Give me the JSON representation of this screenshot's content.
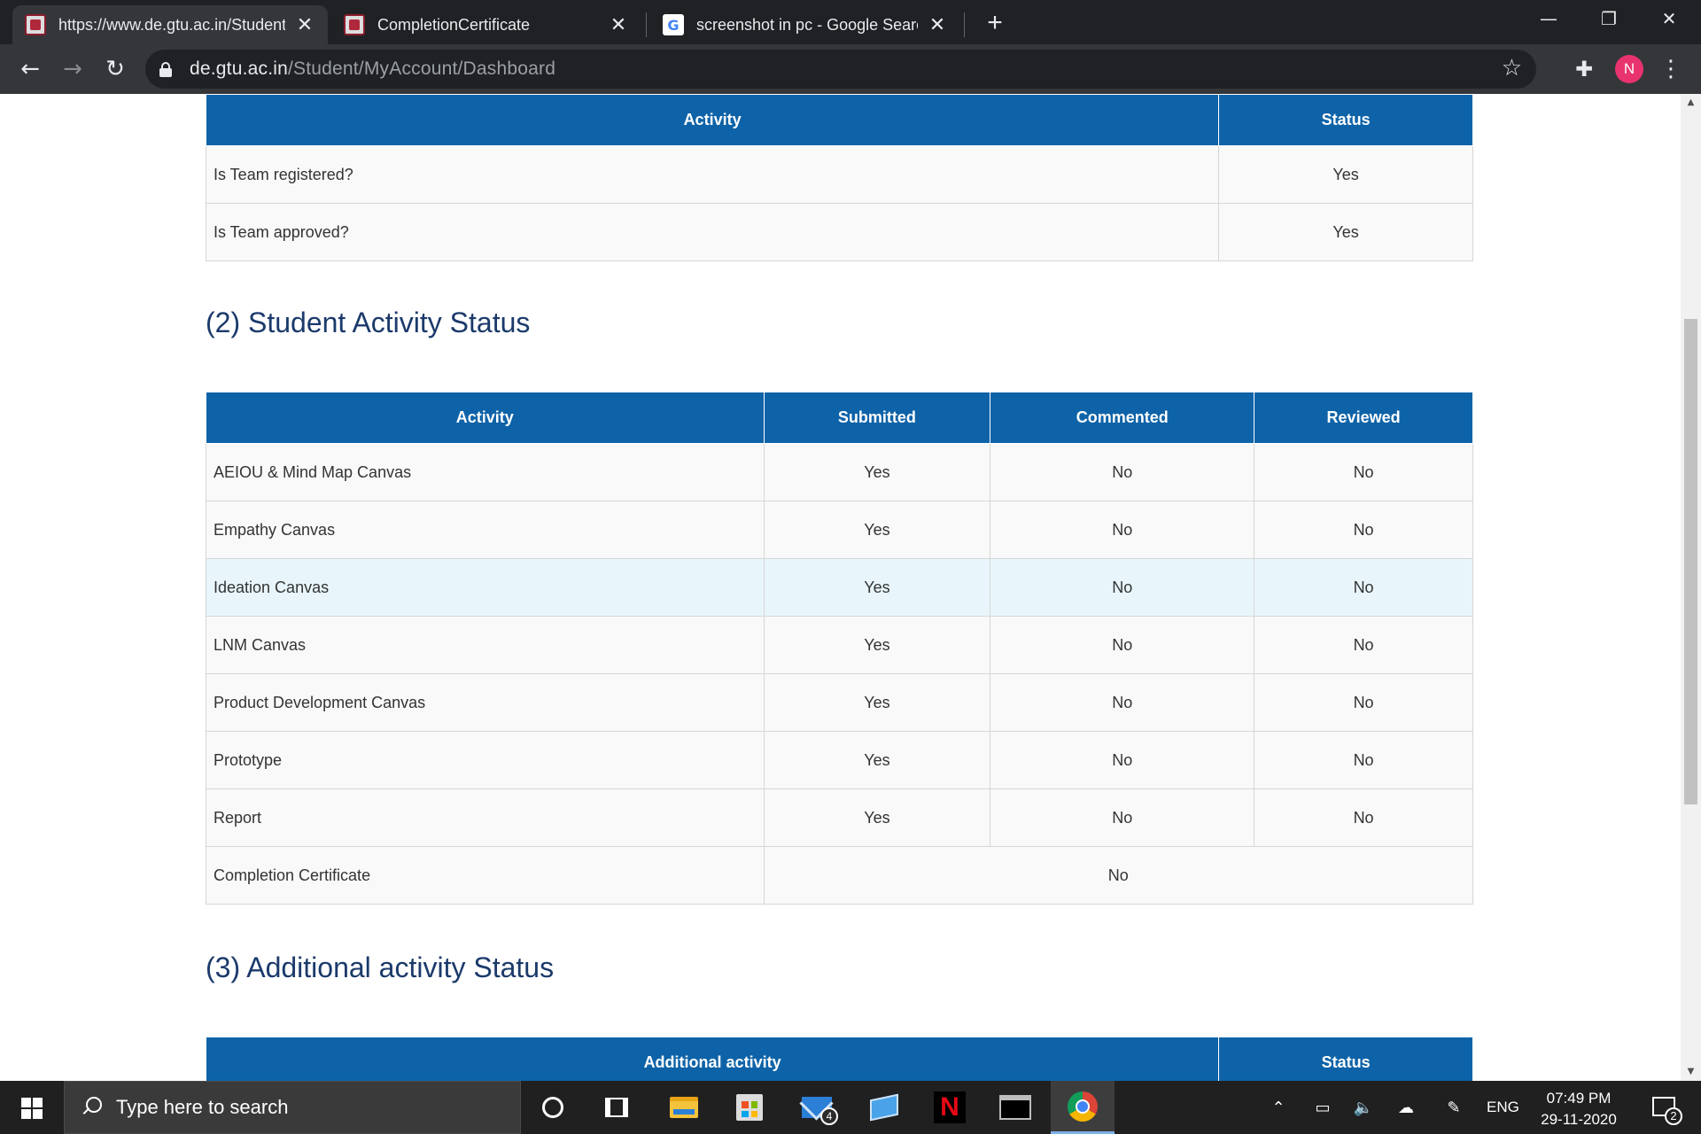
{
  "browser": {
    "tabs": [
      {
        "title": "https://www.de.gtu.ac.in/Student/MyAccount/Dashboard",
        "icon": "gtu-favicon",
        "active": true
      },
      {
        "title": "CompletionCertificate",
        "icon": "gtu-favicon",
        "active": false
      },
      {
        "title": "screenshot in pc - Google Search",
        "icon": "google-favicon",
        "active": false
      }
    ],
    "close_glyph": "✕",
    "new_tab_glyph": "+",
    "window_controls": {
      "minimize": "—",
      "restore": "❐",
      "close": "✕"
    },
    "url_host": "de.gtu.ac.in",
    "url_path": "/Student/MyAccount/Dashboard",
    "profile_initial": "N"
  },
  "team_table": {
    "headers": [
      "Activity",
      "Status"
    ],
    "rows": [
      {
        "activity": "Is Team registered?",
        "status": "Yes"
      },
      {
        "activity": "Is Team approved?",
        "status": "Yes"
      }
    ]
  },
  "section2": {
    "title": "(2) Student Activity Status",
    "headers": [
      "Activity",
      "Submitted",
      "Commented",
      "Reviewed"
    ],
    "rows": [
      {
        "activity": "AEIOU & Mind Map Canvas",
        "submitted": "Yes",
        "commented": "No",
        "reviewed": "No"
      },
      {
        "activity": "Empathy Canvas",
        "submitted": "Yes",
        "commented": "No",
        "reviewed": "No"
      },
      {
        "activity": "Ideation Canvas",
        "submitted": "Yes",
        "commented": "No",
        "reviewed": "No"
      },
      {
        "activity": "LNM Canvas",
        "submitted": "Yes",
        "commented": "No",
        "reviewed": "No"
      },
      {
        "activity": "Product Development Canvas",
        "submitted": "Yes",
        "commented": "No",
        "reviewed": "No"
      },
      {
        "activity": "Prototype",
        "submitted": "Yes",
        "commented": "No",
        "reviewed": "No"
      },
      {
        "activity": "Report",
        "submitted": "Yes",
        "commented": "No",
        "reviewed": "No"
      }
    ],
    "certificate": {
      "activity": "Completion Certificate",
      "status": "No"
    }
  },
  "section3": {
    "title": "(3) Additional activity Status",
    "headers": [
      "Additional activity",
      "Status"
    ]
  },
  "taskbar": {
    "search_placeholder": "Type here to search",
    "mail_badge": "4",
    "netflix_letter": "N",
    "language": "ENG",
    "time": "07:49 PM",
    "date": "29-11-2020",
    "notification_count": "2"
  },
  "colors": {
    "header_blue": "#0e63a8",
    "yes_green": "#1a8a1a",
    "no_red": "#e01010",
    "title_navy": "#1b3a6b",
    "highlight_row": "#e8f6fb"
  }
}
